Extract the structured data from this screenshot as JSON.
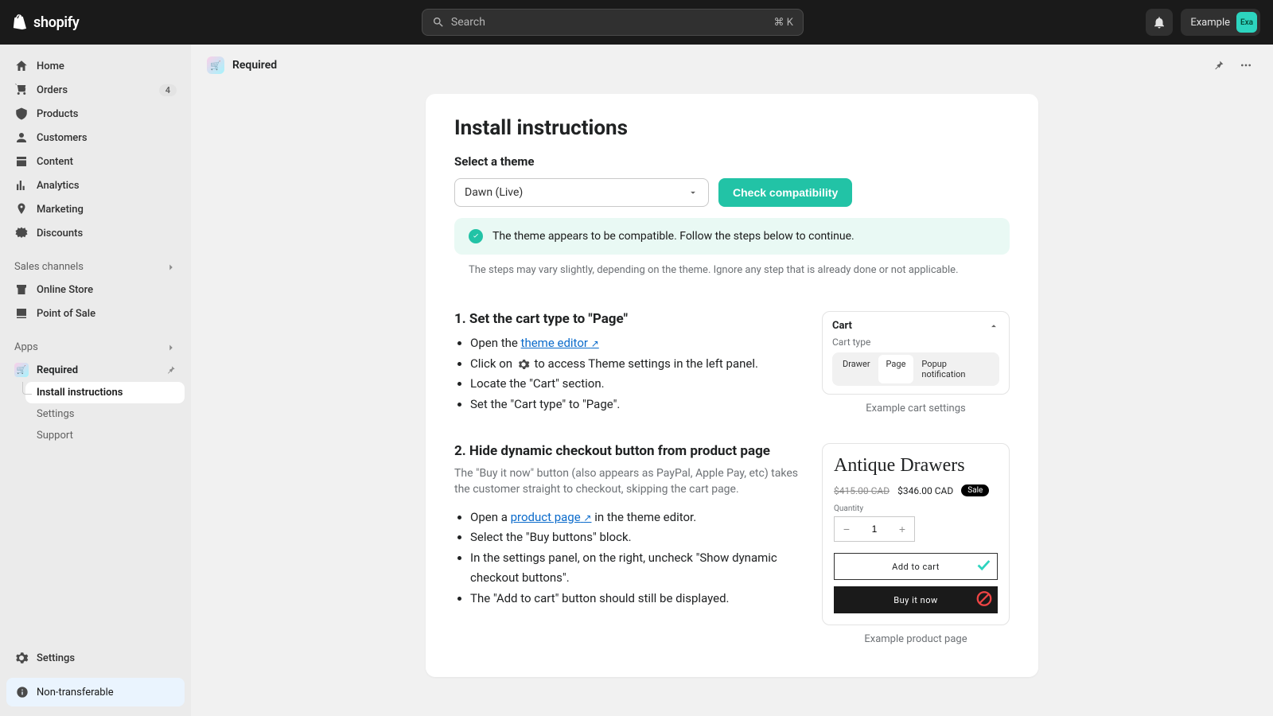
{
  "topbar": {
    "brand": "shopify",
    "search_placeholder": "Search",
    "search_kbd": "⌘ K",
    "account_name": "Example",
    "avatar_initials": "Exa"
  },
  "sidebar": {
    "items": [
      {
        "label": "Home"
      },
      {
        "label": "Orders",
        "badge": "4"
      },
      {
        "label": "Products"
      },
      {
        "label": "Customers"
      },
      {
        "label": "Content"
      },
      {
        "label": "Analytics"
      },
      {
        "label": "Marketing"
      },
      {
        "label": "Discounts"
      }
    ],
    "sales_section": "Sales channels",
    "sales": [
      {
        "label": "Online Store"
      },
      {
        "label": "Point of Sale"
      }
    ],
    "apps_section": "Apps",
    "app_name": "Required",
    "app_sub": [
      {
        "label": "Install instructions"
      },
      {
        "label": "Settings"
      },
      {
        "label": "Support"
      }
    ],
    "settings": "Settings",
    "nontransferable": "Non-transferable"
  },
  "header": {
    "app_label": "Required"
  },
  "content": {
    "title": "Install instructions",
    "select_theme": "Select a theme",
    "theme_value": "Dawn (Live)",
    "check_btn": "Check compatibility",
    "alert": "The theme appears to be compatible. Follow the steps below to continue.",
    "note": "The steps may vary slightly, depending on the theme. Ignore any step that is already done or not applicable.",
    "step1": {
      "title": "1. Set the cart type to \"Page\"",
      "b1_pre": "Open the ",
      "b1_link": "theme editor",
      "b2_pre": "Click on ",
      "b2_post": " to access Theme settings in the left panel.",
      "b3": "Locate the \"Cart\" section.",
      "b4": "Set the \"Cart type\" to \"Page\".",
      "ex_head": "Cart",
      "ex_label": "Cart type",
      "seg": [
        "Drawer",
        "Page",
        "Popup notification"
      ],
      "caption": "Example cart settings"
    },
    "step2": {
      "title": "2. Hide dynamic checkout button from product page",
      "desc": "The \"Buy it now\" button (also appears as PayPal, Apple Pay, etc) takes the customer straight to checkout, skipping the cart page.",
      "b1_pre": "Open a ",
      "b1_link": "product page",
      "b1_post": " in the theme editor.",
      "b2": "Select the \"Buy buttons\" block.",
      "b3": "In the settings panel, on the right, uncheck \"Show dynamic checkout buttons\".",
      "b4": "The \"Add to cart\" button should still be displayed.",
      "prod_title": "Antique Drawers",
      "price_old": "$415.00 CAD",
      "price_new": "$346.00 CAD",
      "sale": "Sale",
      "qty_label": "Quantity",
      "qty_val": "1",
      "add_to_cart": "Add to cart",
      "buy_now": "Buy it now",
      "caption": "Example product page"
    }
  }
}
